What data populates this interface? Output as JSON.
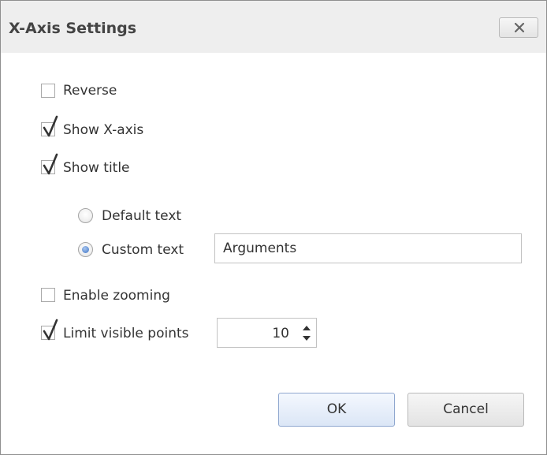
{
  "dialog": {
    "title": "X-Axis Settings",
    "close_icon": "close-icon"
  },
  "options": {
    "reverse": {
      "label": "Reverse",
      "checked": false
    },
    "show_x_axis": {
      "label": "Show X-axis",
      "checked": true
    },
    "show_title": {
      "label": "Show title",
      "checked": true
    },
    "default_text": {
      "label": "Default text",
      "selected": false
    },
    "custom_text": {
      "label": "Custom text",
      "selected": true,
      "value": "Arguments"
    },
    "enable_zooming": {
      "label": "Enable zooming",
      "checked": false
    },
    "limit_visible_points": {
      "label": "Limit visible points",
      "checked": true,
      "value": "10"
    }
  },
  "buttons": {
    "ok": "OK",
    "cancel": "Cancel"
  },
  "colors": {
    "accent": "#3e73c4",
    "titlebar": "#eeeeee",
    "ok_button": "#dbe6f6"
  }
}
